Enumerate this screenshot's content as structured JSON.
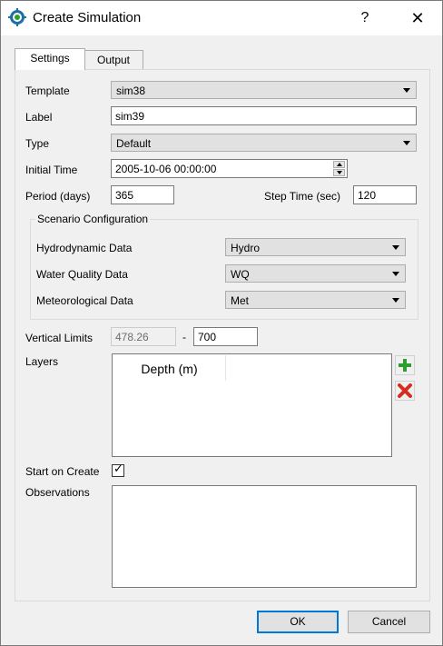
{
  "window": {
    "title": "Create Simulation",
    "help_glyph": "?",
    "close_glyph": "✕"
  },
  "tabs": [
    {
      "label": "Settings",
      "active": true
    },
    {
      "label": "Output",
      "active": false
    }
  ],
  "form": {
    "template": {
      "label": "Template",
      "value": "sim38"
    },
    "label_field": {
      "label": "Label",
      "value": "sim39"
    },
    "type": {
      "label": "Type",
      "value": "Default"
    },
    "initial_time": {
      "label": "Initial Time",
      "value": "2005-10-06 00:00:00"
    },
    "period": {
      "label": "Period (days)",
      "value": "365"
    },
    "step_time": {
      "label": "Step Time (sec)",
      "value": "120"
    }
  },
  "scenario": {
    "title": "Scenario Configuration",
    "hydrodynamic": {
      "label": "Hydrodynamic Data",
      "value": "Hydro"
    },
    "water_quality": {
      "label": "Water Quality Data",
      "value": "WQ"
    },
    "meteorological": {
      "label": "Meteorological Data",
      "value": "Met"
    }
  },
  "vertical_limits": {
    "label": "Vertical Limits",
    "min": "478.26",
    "separator": "-",
    "max": "700"
  },
  "layers": {
    "label": "Layers",
    "column_header": "Depth (m)",
    "add_icon": "plus-icon",
    "remove_icon": "x-icon"
  },
  "start_on_create": {
    "label": "Start on Create",
    "checked": true,
    "check_glyph": "✓"
  },
  "observations": {
    "label": "Observations",
    "value": ""
  },
  "buttons": {
    "ok": "OK",
    "cancel": "Cancel"
  },
  "colors": {
    "accent": "#0078d7",
    "add_green": "#2e9e2e",
    "remove_red": "#d62d20"
  }
}
